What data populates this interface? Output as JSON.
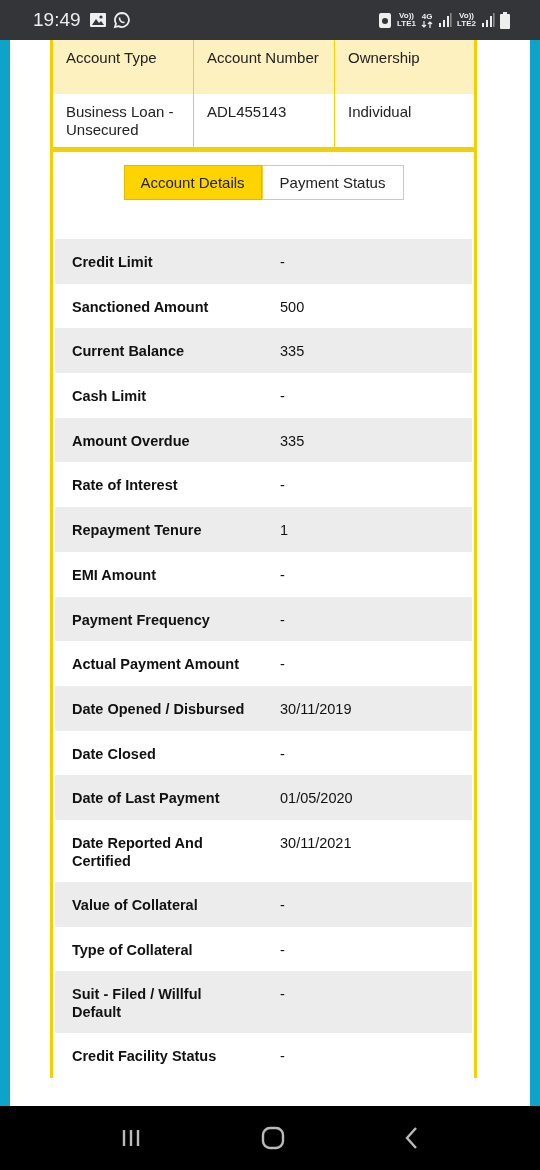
{
  "status_bar": {
    "time": "19:49",
    "network_1": [
      "Vo))",
      "LTE1"
    ],
    "network_type": "4G",
    "network_2": [
      "Vo))",
      "LTE2"
    ]
  },
  "account_table": {
    "columns": [
      "Account Type",
      "Account Number",
      "Ownership"
    ],
    "row": [
      "Business Loan - Unsecured",
      "ADL455143",
      "Individual"
    ]
  },
  "tabs": [
    {
      "label": "Account Details",
      "selected": true
    },
    {
      "label": "Payment Status",
      "selected": false
    }
  ],
  "details": [
    {
      "label": "Credit Limit",
      "value": "-"
    },
    {
      "label": "Sanctioned Amount",
      "value": "500"
    },
    {
      "label": "Current Balance",
      "value": "335"
    },
    {
      "label": "Cash Limit",
      "value": "-"
    },
    {
      "label": "Amount Overdue",
      "value": "335"
    },
    {
      "label": "Rate of Interest",
      "value": "-"
    },
    {
      "label": "Repayment Tenure",
      "value": "1"
    },
    {
      "label": "EMI Amount",
      "value": "-"
    },
    {
      "label": "Payment Frequency",
      "value": "-"
    },
    {
      "label": "Actual Payment Amount",
      "value": "-"
    },
    {
      "label": "Date Opened / Disbursed",
      "value": "30/11/2019"
    },
    {
      "label": "Date Closed",
      "value": "-"
    },
    {
      "label": "Date of Last Payment",
      "value": "01/05/2020"
    },
    {
      "label": "Date Reported And Certified",
      "value": "30/11/2021"
    },
    {
      "label": "Value of Collateral",
      "value": "-"
    },
    {
      "label": "Type of Collateral",
      "value": "-"
    },
    {
      "label": "Suit - Filed / Willful Default",
      "value": "-"
    },
    {
      "label": "Credit Facility Status",
      "value": "-"
    }
  ]
}
